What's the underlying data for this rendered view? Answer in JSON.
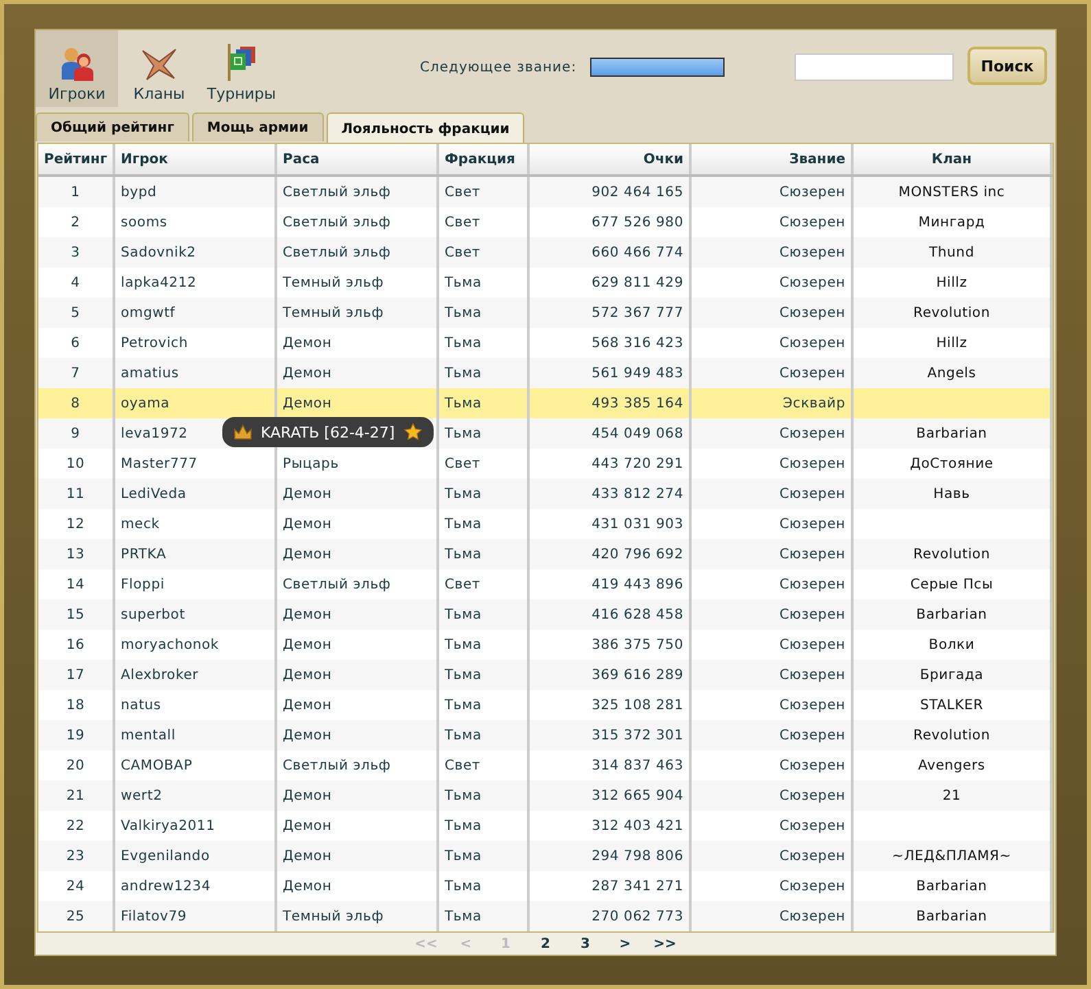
{
  "nav": [
    {
      "label": "Игроки",
      "selected": true
    },
    {
      "label": "Кланы",
      "selected": false
    },
    {
      "label": "Турниры",
      "selected": false
    }
  ],
  "next_rank": {
    "label": "Следующее звание:",
    "level": 1
  },
  "search": {
    "button": "Поиск"
  },
  "tabs": [
    {
      "label": "Общий рейтинг",
      "selected": false
    },
    {
      "label": "Мощь армии",
      "selected": false
    },
    {
      "label": "Лояльность фракции",
      "selected": true
    }
  ],
  "table": {
    "columns": [
      "Рейтинг",
      "Игрок",
      "Раса",
      "Фракция",
      "Очки",
      "Звание",
      "Клан"
    ],
    "rows": [
      {
        "cells": [
          "1",
          "bypd",
          "Светлый эльф",
          "Свет",
          "902 464 165",
          "Сюзерен",
          "MONSTERS inc"
        ],
        "selected": false
      },
      {
        "cells": [
          "2",
          "sooms",
          "Светлый эльф",
          "Свет",
          "677 526 980",
          "Сюзерен",
          "Мингард"
        ],
        "selected": false
      },
      {
        "cells": [
          "3",
          "Sadovnik2",
          "Светлый эльф",
          "Свет",
          "660 466 774",
          "Сюзерен",
          "Thund"
        ],
        "selected": false
      },
      {
        "cells": [
          "4",
          "lapka4212",
          "Темный эльф",
          "Тьма",
          "629 811 429",
          "Сюзерен",
          "Hillz"
        ],
        "selected": false
      },
      {
        "cells": [
          "5",
          "omgwtf",
          "Темный эльф",
          "Тьма",
          "572 367 777",
          "Сюзерен",
          "Revolution"
        ],
        "selected": false
      },
      {
        "cells": [
          "6",
          "Petrovich",
          "Демон",
          "Тьма",
          "568 316 423",
          "Сюзерен",
          "Hillz"
        ],
        "selected": false
      },
      {
        "cells": [
          "7",
          "amatius",
          "Демон",
          "Тьма",
          "561 949 483",
          "Сюзерен",
          "Angels"
        ],
        "selected": false
      },
      {
        "cells": [
          "8",
          "oyama",
          "Демон",
          "Тьма",
          "493 385 164",
          "Эсквайр",
          ""
        ],
        "selected": true
      },
      {
        "cells": [
          "9",
          "leva1972",
          "",
          "Тьма",
          "454 049 068",
          "Сюзерен",
          "Barbarian"
        ],
        "selected": false
      },
      {
        "cells": [
          "10",
          "Master777",
          "Рыцарь",
          "Свет",
          "443 720 291",
          "Сюзерен",
          "ДоСтояние"
        ],
        "selected": false
      },
      {
        "cells": [
          "11",
          "LediVeda",
          "Демон",
          "Тьма",
          "433 812 274",
          "Сюзерен",
          "Навь"
        ],
        "selected": false
      },
      {
        "cells": [
          "12",
          "meck",
          "Демон",
          "Тьма",
          "431 031 903",
          "Сюзерен",
          ""
        ],
        "selected": false
      },
      {
        "cells": [
          "13",
          "PRTKA",
          "Демон",
          "Тьма",
          "420 796 692",
          "Сюзерен",
          "Revolution"
        ],
        "selected": false
      },
      {
        "cells": [
          "14",
          "Floppi",
          "Светлый эльф",
          "Свет",
          "419 443 896",
          "Сюзерен",
          "Серые Псы"
        ],
        "selected": false
      },
      {
        "cells": [
          "15",
          "superbot",
          "Демон",
          "Тьма",
          "416 628 458",
          "Сюзерен",
          "Barbarian"
        ],
        "selected": false
      },
      {
        "cells": [
          "16",
          "moryachonok",
          "Демон",
          "Тьма",
          "386 375 750",
          "Сюзерен",
          "Волки"
        ],
        "selected": false
      },
      {
        "cells": [
          "17",
          "Alexbroker",
          "Демон",
          "Тьма",
          "369 616 289",
          "Сюзерен",
          "Бригада"
        ],
        "selected": false
      },
      {
        "cells": [
          "18",
          "natus",
          "Демон",
          "Тьма",
          "325 108 281",
          "Сюзерен",
          "STALKER"
        ],
        "selected": false
      },
      {
        "cells": [
          "19",
          "mentall",
          "Демон",
          "Тьма",
          "315 372 301",
          "Сюзерен",
          "Revolution"
        ],
        "selected": false
      },
      {
        "cells": [
          "20",
          "САМОВАР",
          "Светлый эльф",
          "Свет",
          "314 837 463",
          "Сюзерен",
          "Avengers"
        ],
        "selected": false
      },
      {
        "cells": [
          "21",
          "wert2",
          "Демон",
          "Тьма",
          "312 665 904",
          "Сюзерен",
          "21"
        ],
        "selected": false
      },
      {
        "cells": [
          "22",
          "Valkirya2011",
          "Демон",
          "Тьма",
          "312 403 421",
          "Сюзерен",
          ""
        ],
        "selected": false
      },
      {
        "cells": [
          "23",
          "Evgenilando",
          "Демон",
          "Тьма",
          "294 798 806",
          "Сюзерен",
          "~ЛЕД&ПЛАМЯ~"
        ],
        "selected": false
      },
      {
        "cells": [
          "24",
          "andrew1234",
          "Демон",
          "Тьма",
          "287 341 271",
          "Сюзерен",
          "Barbarian"
        ],
        "selected": false
      },
      {
        "cells": [
          "25",
          "Filatov79",
          "Темный эльф",
          "Тьма",
          "270 062 773",
          "Сюзерен",
          "Barbarian"
        ],
        "selected": false
      }
    ]
  },
  "tooltip": {
    "text": "KARATЬ [62-4-27]"
  },
  "pagination": [
    {
      "label": "<<",
      "disabled": true
    },
    {
      "label": "<",
      "disabled": true
    },
    {
      "label": "1",
      "disabled": true
    },
    {
      "label": "2",
      "disabled": false
    },
    {
      "label": "3",
      "disabled": false
    },
    {
      "label": ">",
      "disabled": false
    },
    {
      "label": ">>",
      "disabled": false
    }
  ]
}
